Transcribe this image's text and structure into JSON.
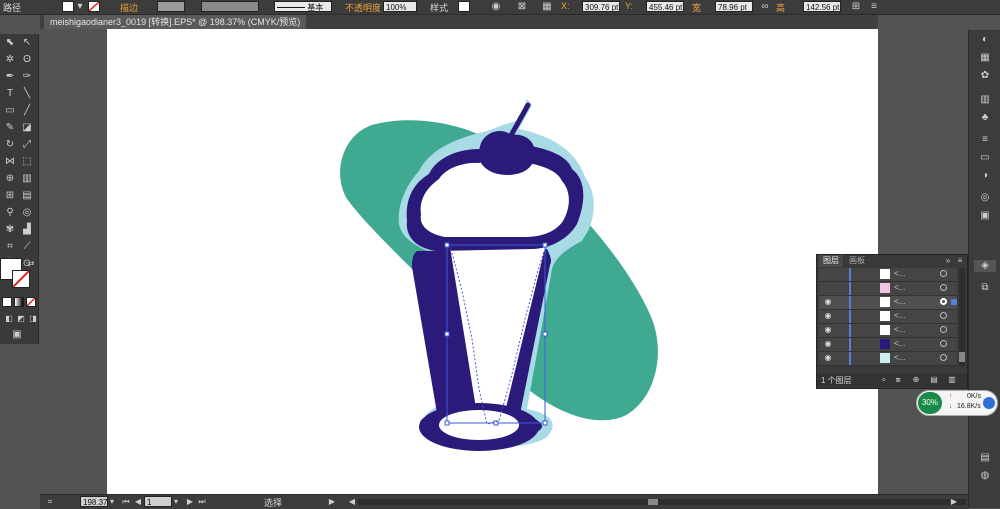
{
  "control_bar": {
    "object_type": "路径",
    "stroke_label": "描边",
    "stroke_profile": "基本",
    "opacity_label": "不透明度",
    "opacity_value": "100%",
    "style_label": "样式",
    "x_label": "X:",
    "x_value": "309.76 pt",
    "y_label": "Y:",
    "y_value": "455.46 pt",
    "w_label": "宽",
    "w_value": "78.96 pt",
    "h_label": "高",
    "h_value": "142.56 pt"
  },
  "document_tab": {
    "label": "meishigaodianer3_0019  [转换].EPS* @ 198.37% (CMYK/预览)"
  },
  "layers_panel": {
    "tab_layers": "图层",
    "tab_artboards": "画板",
    "layer_count": "1 个图层",
    "rows": [
      {
        "label": "<..."
      },
      {
        "label": "<..."
      },
      {
        "label": "<..."
      },
      {
        "label": "<..."
      },
      {
        "label": "<..."
      },
      {
        "label": "<..."
      },
      {
        "label": "<..."
      },
      {
        "label": "<..."
      }
    ]
  },
  "status_bar": {
    "zoom": "198.37",
    "artboard_num": "1",
    "mode": "选择"
  },
  "net_widget": {
    "cpu_percent": "30%",
    "upload": "0K/s",
    "download": "16.8K/s"
  },
  "colors": {
    "cream": "#a8dbe6",
    "navy": "#2b1a7a",
    "teal": "#3fa992",
    "selection_blue": "#3a5cd6"
  }
}
